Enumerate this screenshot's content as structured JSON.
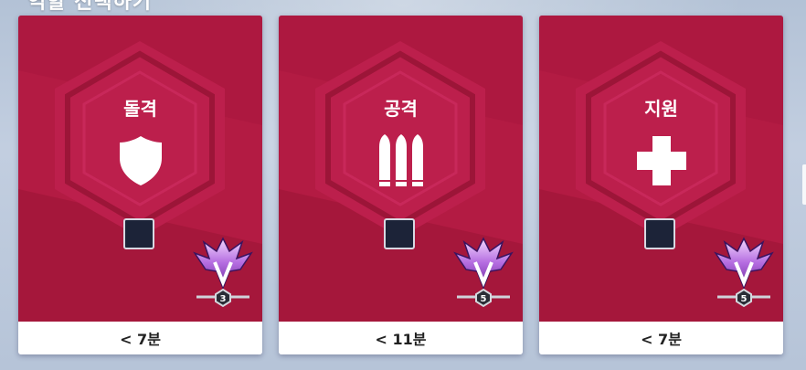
{
  "header": {
    "title": "역할 선택하기"
  },
  "colors": {
    "card": "#b31b43",
    "card_dark": "#8f1335",
    "footer": "#ffffff",
    "rank_box": "#1c2338"
  },
  "cards": [
    {
      "role": "돌격",
      "icon": "shield-icon",
      "rank_icon": "grandmaster-rank-icon",
      "tier": "3",
      "wait": "< 7분"
    },
    {
      "role": "공격",
      "icon": "bullets-icon",
      "rank_icon": "grandmaster-rank-icon",
      "tier": "5",
      "wait": "< 11분"
    },
    {
      "role": "지원",
      "icon": "cross-icon",
      "rank_icon": "grandmaster-rank-icon",
      "tier": "5",
      "wait": "< 7분"
    }
  ]
}
